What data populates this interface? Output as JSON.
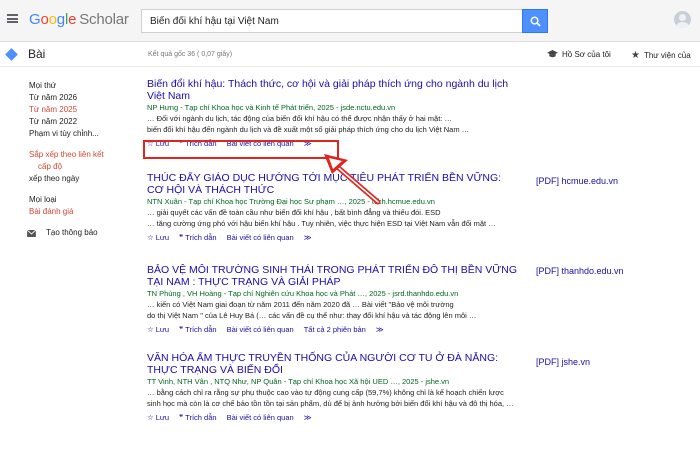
{
  "header": {
    "logo_google": "Google",
    "logo_scholar": "Scholar",
    "search_value": "Biến đổi khí hậu tại Việt Nam"
  },
  "subheader": {
    "section": "Bài",
    "result_count": "Kết quả gốc 36 ( 0,07 giây)",
    "profile_link": "Hồ Sơ của tôi",
    "library_link": "Thư viện của"
  },
  "sidebar": {
    "time_filters": [
      "Mọi thứ",
      "Từ năm 2026",
      "Từ năm 2025",
      "Từ năm 2022",
      "Phạm vi tùy chỉnh..."
    ],
    "sort": [
      "Sắp xếp theo liên kết",
      "cấp độ",
      "xếp theo ngày"
    ],
    "types": [
      "Mọi loại",
      "Bài đánh giá"
    ],
    "alert": "Tạo thông báo"
  },
  "results": [
    {
      "title_lines": [
        "Biến đổi khí hậu: Thách thức, cơ hội và giải pháp thích ứng cho ngành du lịch",
        "Việt Nam"
      ],
      "meta": "NP Hưng - Tạp chí Khoa học và Kinh tế Phát triển, 2025 - jsde.nctu.edu.vn",
      "snippet": [
        "… Đối với ngành du lịch, tác động của biến đổi khí hậu có thể được nhận thấy ở hai mặt: …",
        "biến đổi khí hậu đến ngành du lịch và đề xuất một số giải pháp thích ứng cho du lịch Việt Nam …"
      ],
      "actions": [
        "Lưu",
        "Trích dẫn",
        "Bài viết có liên quan"
      ],
      "pdf": ""
    },
    {
      "title_lines": [
        "THÚC ĐẨY GIÁO DỤC HƯỚNG TỚI MỤC TIÊU PHÁT TRIỂN BỀN VỮNG:",
        "CƠ HỘI VÀ THÁCH THỨC"
      ],
      "meta": "NTN Xuân - Tạp chí Khoa học Trường Đại học Sư phạm …, 2025 - tckh.hcmue.edu.vn",
      "snippet": [
        "… giải quyết các vấn đề toàn cầu như biến đổi khí hậu , bất bình đẳng và thiếu đói. ESD",
        "… tăng cường ứng phó với hậu biến khí hậu . Tuy nhiên, việc thực hiện ESD tại Việt Nam vẫn đối mặt …"
      ],
      "actions": [
        "Lưu",
        "Trích dẫn",
        "Bài viết có liên quan"
      ],
      "pdf": "[PDF] hcmue.edu.vn"
    },
    {
      "title_lines": [
        "BẢO VỆ MÔI TRƯỜNG SINH THÁI TRONG PHÁT TRIỂN ĐÔ THỊ BỀN VỮNG",
        "TẠI NAM : THỰC TRẠNG VÀ GIẢI PHÁP"
      ],
      "meta": "TN Phùng , VH Hoàng - Tạp chí Nghiên cứu Khoa học và Phát …, 2025 - jsrd.thanhdo.edu.vn",
      "snippet": [
        "… kiến có Việt Nam giai đoạn từ năm 2011 đến năm 2020 đã … Bài viết \"Bảo vệ môi trường",
        "do thị Việt Nam \" của Lê Huy Bá (… các vấn đề cụ thể như: thay đổi khí hậu và tác động lên môi …"
      ],
      "actions": [
        "Lưu",
        "Trích dẫn",
        "Bài viết có liên quan",
        "Tất cả 2 phiên bản"
      ],
      "pdf": "[PDF] thanhdo.edu.vn"
    },
    {
      "title_lines": [
        "VĂN HÓA ẨM THỰC TRUYỀN THỐNG CỦA NGƯỜI CƠ TU Ở ĐÀ NẴNG:",
        "THỰC TRẠNG VÀ BIẾN ĐỔI"
      ],
      "meta": "TT Vinh, NTH Vân , NTQ Như, NP Quân - Tạp chí Khoa học Xã hội UED …, 2025 - jshe.vn",
      "snippet": [
        "… bằng cách chỉ ra rằng sự phụ thuộc cao vào tự động cung cấp (59,7%) không chỉ là kế hoạch chiến lược",
        "sinh học mà còn là cơ chế bảo tồn tồn tại sản phẩm, dù để bị ảnh hưởng bởi biến đổi khí hậu và đô thị hóa, …"
      ],
      "actions": [
        "Lưu",
        "Trích dẫn",
        "Bài viết có liên quan"
      ],
      "pdf": "[PDF] jshe.vn"
    }
  ],
  "colors": {
    "link": "#1a0dab",
    "meta": "#006621",
    "accent_red": "#d14836",
    "highlight": "#e0251f",
    "search_button": "#4d90fe"
  }
}
